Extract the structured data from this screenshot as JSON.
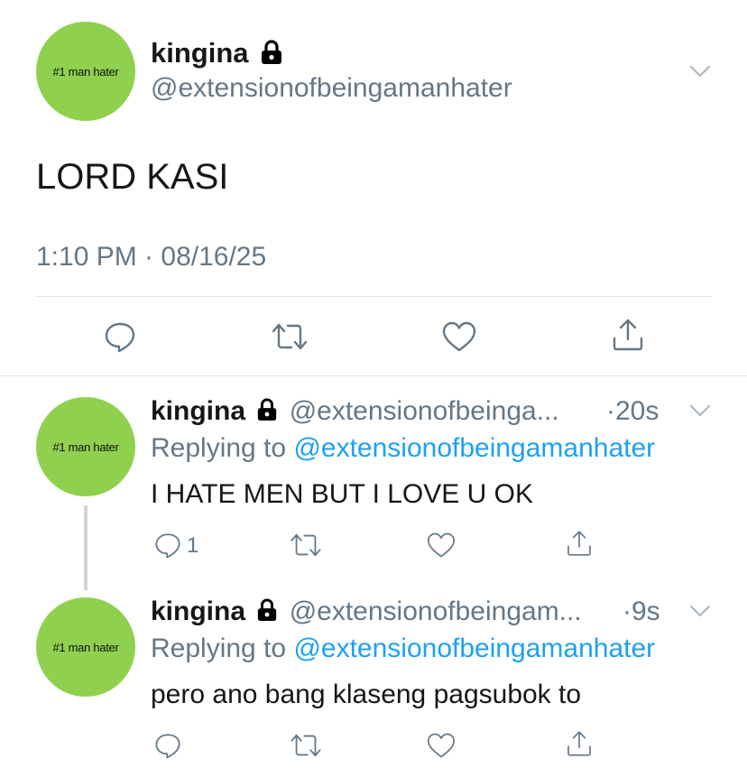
{
  "main_tweet": {
    "avatar_text": "#1 man hater",
    "name": "kingina",
    "handle": "@extensionofbeingamanhater",
    "text": "LORD KASI",
    "timestamp": "1:10 PM · 08/16/25",
    "icons": [
      "reply-icon",
      "retweet-icon",
      "like-icon",
      "share-icon"
    ]
  },
  "replies": [
    {
      "avatar_text": "#1 man hater",
      "name": "kingina",
      "handle": "@extensionofbeinga...",
      "time": "·20s",
      "replying_prefix": "Replying to",
      "replying_handle": "@extensionofbeingamanhater",
      "text": "I HATE MEN BUT I LOVE U OK",
      "reply_count": "1"
    },
    {
      "avatar_text": "#1 man hater",
      "name": "kingina",
      "handle": "@extensionofbeingam...",
      "time": "·9s",
      "replying_prefix": "Replying to",
      "replying_handle": "@extensionofbeingamanhater",
      "text": "pero ano bang klaseng pagsubok to",
      "reply_count": ""
    }
  ],
  "colors": {
    "avatar_bg": "#8fd14f",
    "link": "#1da1f2",
    "secondary": "#657786",
    "divider": "#dfe3e6"
  }
}
